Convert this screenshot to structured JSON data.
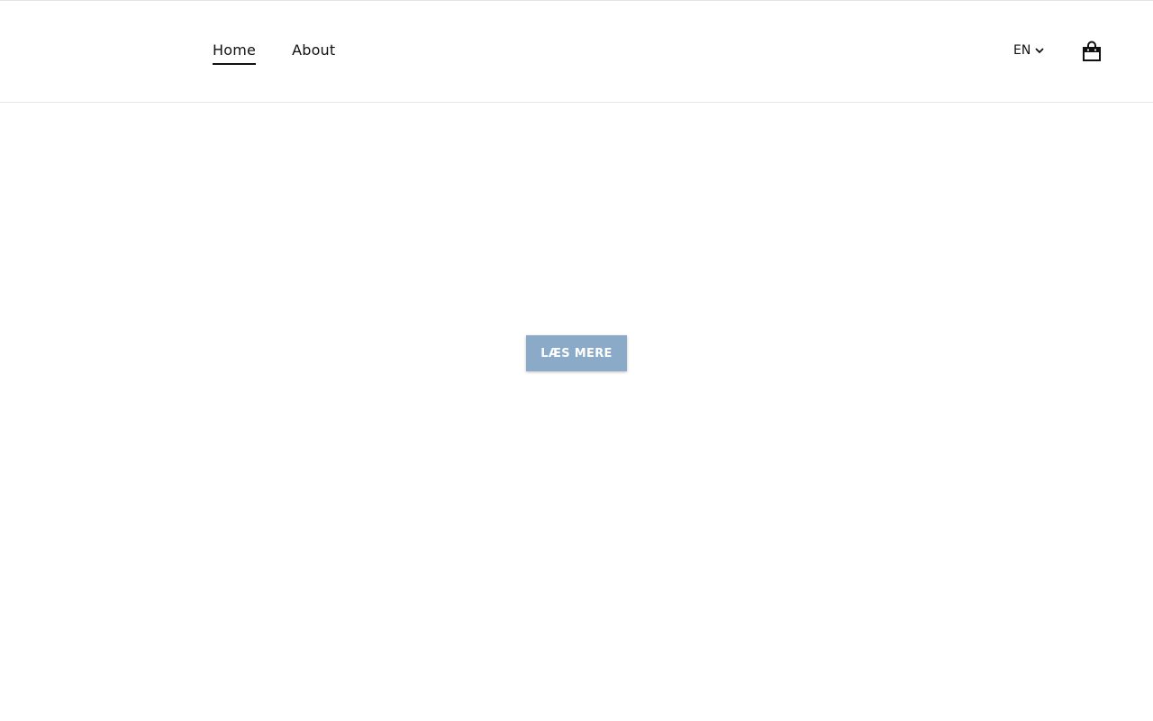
{
  "nav": {
    "items": [
      {
        "label": "Home",
        "active": true
      },
      {
        "label": "About",
        "active": false
      }
    ]
  },
  "language": {
    "selected": "EN",
    "icon": "chevron-down-icon"
  },
  "cart": {
    "icon": "shopping-bag-icon"
  },
  "hero": {
    "cta_label": "LÆS MERE",
    "cta_color": "#8aaac8"
  }
}
